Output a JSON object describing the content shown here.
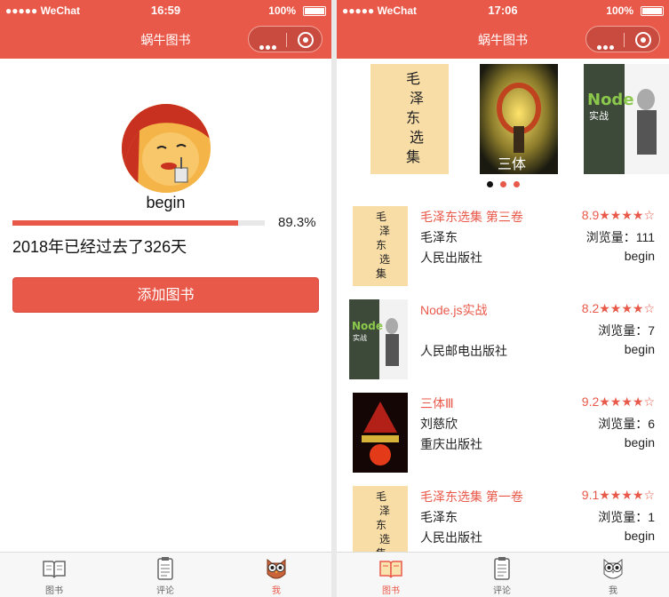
{
  "left": {
    "statusbar": {
      "carrier": "●●●●● WeChat",
      "time": "16:59",
      "battery": "100%"
    },
    "navbar": {
      "title": "蜗牛图书"
    },
    "profile": {
      "username": "begin",
      "progress_value": 0.893,
      "progress_text": "89.3%",
      "days_text": "2018年已经过去了326天"
    },
    "add_button": "添加图书"
  },
  "right": {
    "statusbar": {
      "carrier": "●●●●● WeChat",
      "time": "17:06",
      "battery": "100%"
    },
    "navbar": {
      "title": "蜗牛图书"
    },
    "carousel": {
      "slides": [
        "mao-selected-works-cover",
        "three-body-cover",
        "nodejs-cover"
      ],
      "active_index": 0
    },
    "books": [
      {
        "title": "毛泽东选集 第三卷",
        "rating": "8.9★★★★☆",
        "author": "毛泽东",
        "views": "浏览量：111",
        "publisher": "人民出版社",
        "uploader": "begin"
      },
      {
        "title": "Node.js实战",
        "rating": "8.2★★★★☆",
        "author": "",
        "views": "浏览量：7",
        "publisher": "人民邮电出版社",
        "uploader": "begin"
      },
      {
        "title": "三体Ⅲ",
        "rating": "9.2★★★★☆",
        "author": "刘慈欣",
        "views": "浏览量：6",
        "publisher": "重庆出版社",
        "uploader": "begin"
      },
      {
        "title": "毛泽东选集 第一卷",
        "rating": "9.1★★★★☆",
        "author": "毛泽东",
        "views": "浏览量：1",
        "publisher": "人民出版社",
        "uploader": "begin"
      }
    ]
  },
  "tabbar": {
    "items": [
      {
        "label": "图书",
        "icon": "book-icon"
      },
      {
        "label": "评论",
        "icon": "clipboard-icon"
      },
      {
        "label": "我",
        "icon": "owl-icon"
      }
    ],
    "left_active": "我",
    "right_active": "图书"
  },
  "colors": {
    "accent": "#e9594a",
    "tab_bg": "#f7f7f7"
  }
}
